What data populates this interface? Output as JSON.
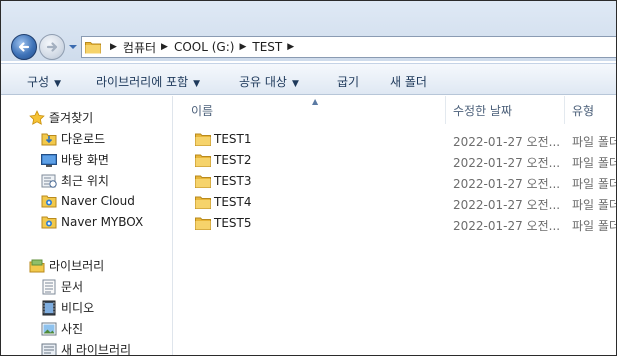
{
  "address": {
    "crumbs": [
      "컴퓨터",
      "COOL (G:)",
      "TEST"
    ]
  },
  "toolbar": {
    "organize": "구성",
    "include_in_library": "라이브러리에 포함",
    "share_with": "공유 대상",
    "burn": "굽기",
    "new_folder": "새 폴더"
  },
  "sidebar": {
    "favorites": "즐겨찾기",
    "favorite_items": [
      "다운로드",
      "바탕 화면",
      "최근 위치",
      "Naver Cloud",
      "Naver MYBOX"
    ],
    "libraries": "라이브러리",
    "library_items": [
      "문서",
      "비디오",
      "사진",
      "새 라이브러리"
    ]
  },
  "columns": {
    "name": "이름",
    "date": "수정한 날짜",
    "type": "유형"
  },
  "files": [
    {
      "name": "TEST1",
      "date": "2022-01-27 오전...",
      "type": "파일 폴더"
    },
    {
      "name": "TEST2",
      "date": "2022-01-27 오전...",
      "type": "파일 폴더"
    },
    {
      "name": "TEST3",
      "date": "2022-01-27 오전...",
      "type": "파일 폴더"
    },
    {
      "name": "TEST4",
      "date": "2022-01-27 오전...",
      "type": "파일 폴더"
    },
    {
      "name": "TEST5",
      "date": "2022-01-27 오전...",
      "type": "파일 폴더"
    }
  ],
  "colors": {
    "accent": "#1e395b",
    "folder": "#f2c94c"
  }
}
